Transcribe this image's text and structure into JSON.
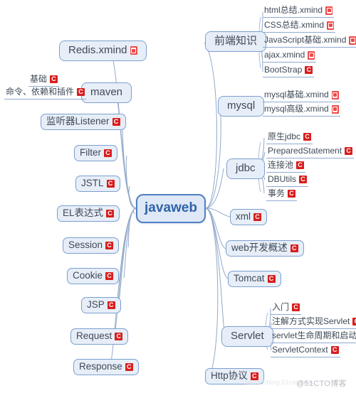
{
  "meta": {
    "title": "javaweb",
    "diagram_type": "mind-map",
    "colors": {
      "root_fill": "#dfe8f6",
      "root_border": "#4f80c4",
      "root_text": "#2f63a8",
      "node_fill": "#e7eef8",
      "node_border": "#7c9fd0",
      "node_text": "#3f4a57",
      "edge": "#93a9c9",
      "underline": "#8fa9cf",
      "icon_c": "#d91d1d",
      "icon_xmind": "#ef4a4a",
      "background": "#ffffff"
    }
  },
  "root": {
    "label": "javaweb"
  },
  "watermark": {
    "text": "@51CTO博客",
    "faint_text": "https://blog.51cto.com"
  },
  "branches": [
    {
      "id": "redis",
      "label": "Redis.xmind",
      "icon": "xmind-icon",
      "children": []
    },
    {
      "id": "maven",
      "label": "maven",
      "icon": null,
      "children": [
        {
          "label": "基础",
          "icon": "c-icon"
        },
        {
          "label": "命令、依赖和插件",
          "icon": "c-icon"
        }
      ]
    },
    {
      "id": "listener",
      "label": "监听器Listener",
      "icon": "c-icon",
      "children": []
    },
    {
      "id": "filter",
      "label": "Filter",
      "icon": "c-icon",
      "children": []
    },
    {
      "id": "jstl",
      "label": "JSTL",
      "icon": "c-icon",
      "children": []
    },
    {
      "id": "el",
      "label": "EL表达式",
      "icon": "c-icon",
      "children": []
    },
    {
      "id": "session",
      "label": "Session",
      "icon": "c-icon",
      "children": []
    },
    {
      "id": "cookie",
      "label": "Cookie",
      "icon": "c-icon",
      "children": []
    },
    {
      "id": "jsp",
      "label": "JSP",
      "icon": "c-icon",
      "children": []
    },
    {
      "id": "request",
      "label": "Request",
      "icon": "c-icon",
      "children": []
    },
    {
      "id": "response",
      "label": "Response",
      "icon": "c-icon",
      "children": []
    },
    {
      "id": "frontend",
      "label": "前端知识",
      "icon": null,
      "children": [
        {
          "label": "html总结.xmind",
          "icon": "xmind-icon"
        },
        {
          "label": "CSS总结.xmind",
          "icon": "xmind-icon"
        },
        {
          "label": "JavaScript基础.xmind",
          "icon": "xmind-icon"
        },
        {
          "label": "ajax.xmind",
          "icon": "xmind-icon"
        },
        {
          "label": "BootStrap",
          "icon": "c-icon"
        }
      ]
    },
    {
      "id": "mysql",
      "label": "mysql",
      "icon": null,
      "children": [
        {
          "label": "mysql基础.xmind",
          "icon": "xmind-icon"
        },
        {
          "label": "mysql高级.xmind",
          "icon": "xmind-icon"
        }
      ]
    },
    {
      "id": "jdbc",
      "label": "jdbc",
      "icon": null,
      "children": [
        {
          "label": "原生jdbc",
          "icon": "c-icon"
        },
        {
          "label": "PreparedStatement",
          "icon": "c-icon"
        },
        {
          "label": "连接池",
          "icon": "c-icon"
        },
        {
          "label": "DBUtils",
          "icon": "c-icon"
        },
        {
          "label": "事务",
          "icon": "c-icon"
        }
      ]
    },
    {
      "id": "xml",
      "label": "xml",
      "icon": "c-icon",
      "children": []
    },
    {
      "id": "webdev",
      "label": "web开发概述",
      "icon": "c-icon",
      "children": []
    },
    {
      "id": "tomcat",
      "label": "Tomcat",
      "icon": "c-icon",
      "children": []
    },
    {
      "id": "servlet",
      "label": "Servlet",
      "icon": null,
      "children": [
        {
          "label": "入门",
          "icon": "c-icon"
        },
        {
          "label": "注解方式实现Servlet",
          "icon": "c-icon"
        },
        {
          "label": "servlet生命周期和启动",
          "icon": "c-icon"
        },
        {
          "label": "ServletContext",
          "icon": "c-icon"
        }
      ]
    },
    {
      "id": "http",
      "label": "Http协议",
      "icon": "c-icon",
      "children": []
    }
  ]
}
